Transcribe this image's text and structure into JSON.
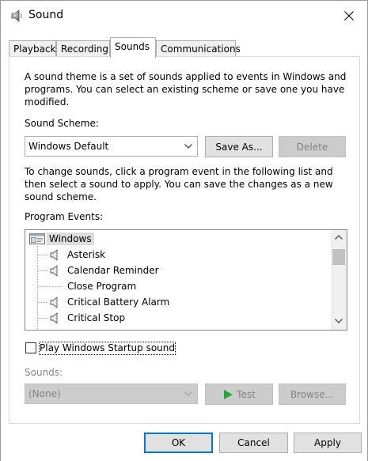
{
  "window": {
    "title": "Sound",
    "close_label": "×"
  },
  "tabs": [
    {
      "label": "Playback"
    },
    {
      "label": "Recording"
    },
    {
      "label": "Sounds"
    },
    {
      "label": "Communications"
    }
  ],
  "sounds_tab": {
    "intro_line1": "A sound theme is a set of sounds applied to events in Windows and",
    "intro_line2": "programs.  You can select an existing scheme or save one you have",
    "intro_line3": "modified.",
    "scheme_label": "Sound Scheme:",
    "scheme_value": "Windows Default",
    "save_as_label": "Save As...",
    "delete_label": "Delete",
    "help_line1": "To change sounds, click a program event in the following list and",
    "help_line2": "then select a sound to apply.  You can save the changes as a new",
    "help_line3": "sound scheme.",
    "events_label": "Program Events:",
    "events": [
      {
        "label": "Windows",
        "icon": "window-icon",
        "level": 0,
        "has_sound": false
      },
      {
        "label": "Asterisk",
        "icon": "speaker-icon",
        "level": 1,
        "has_sound": true
      },
      {
        "label": "Calendar Reminder",
        "icon": "speaker-icon",
        "level": 1,
        "has_sound": true
      },
      {
        "label": "Close Program",
        "icon": "",
        "level": 1,
        "has_sound": false
      },
      {
        "label": "Critical Battery Alarm",
        "icon": "speaker-icon",
        "level": 1,
        "has_sound": true
      },
      {
        "label": "Critical Stop",
        "icon": "speaker-icon",
        "level": 1,
        "has_sound": true
      }
    ],
    "startup_label": "Play Windows Startup sound",
    "startup_checked": false,
    "sounds_label": "Sounds:",
    "sounds_value": "(None)",
    "test_label": "Test",
    "browse_label": "Browse..."
  },
  "footer": {
    "ok_label": "OK",
    "cancel_label": "Cancel",
    "apply_label": "Apply"
  },
  "colors": {
    "accent": "#0078d7",
    "disabled_bg": "#cccccc",
    "disabled_text": "#838383",
    "selected_row": "#dddddd",
    "play_green": "#22a539"
  }
}
